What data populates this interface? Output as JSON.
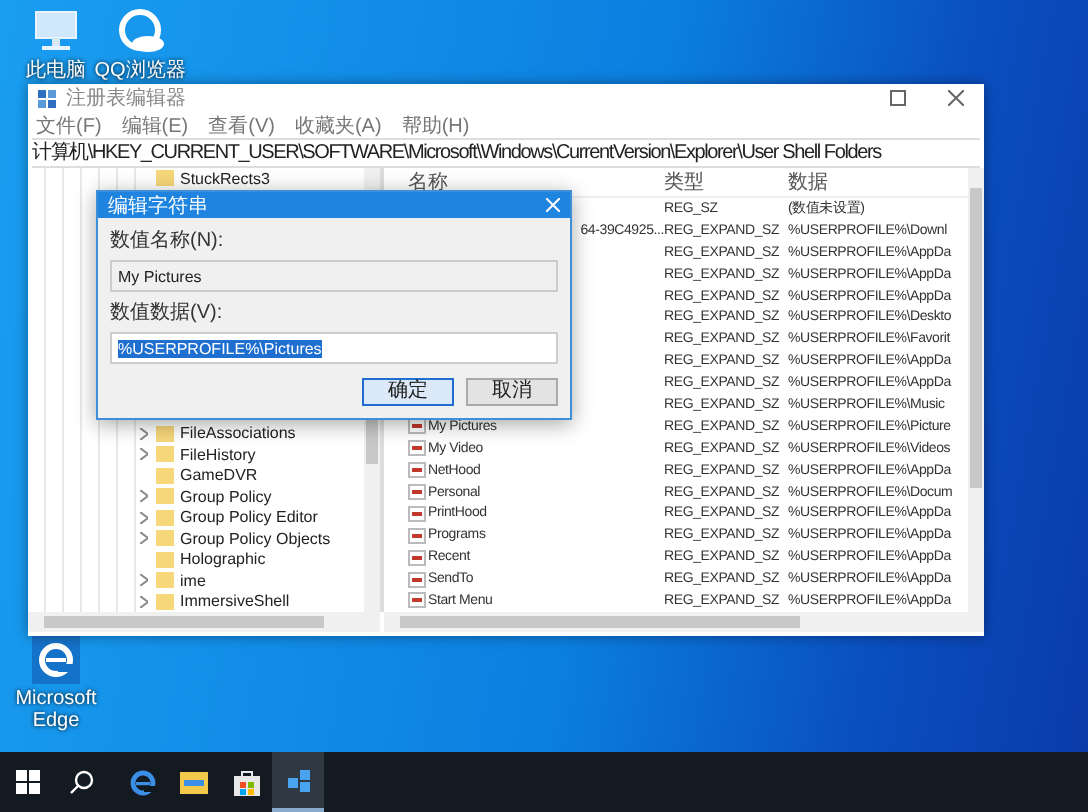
{
  "desktop_icons": [
    {
      "kind": "computer",
      "label": "此电脑"
    },
    {
      "kind": "browser",
      "label": "QQ浏览器"
    },
    {
      "kind": "edge",
      "label": "Microsoft Edge"
    }
  ],
  "window": {
    "title": "注册表编辑器",
    "menu": [
      "文件(F)",
      "编辑(E)",
      "查看(V)",
      "收藏夹(A)",
      "帮助(H)"
    ],
    "address": "计算机\\HKEY_CURRENT_USER\\SOFTWARE\\Microsoft\\Windows\\CurrentVersion\\Explorer\\User Shell Folders"
  },
  "tree": {
    "top_items": [
      {
        "label": "StuckRects3",
        "expandable": false
      }
    ],
    "bottom_items": [
      {
        "label": "FileAssociations",
        "expandable": true
      },
      {
        "label": "FileHistory",
        "expandable": true
      },
      {
        "label": "GameDVR",
        "expandable": false
      },
      {
        "label": "Group Policy",
        "expandable": true
      },
      {
        "label": "Group Policy Editor",
        "expandable": true
      },
      {
        "label": "Group Policy Objects",
        "expandable": true
      },
      {
        "label": "Holographic",
        "expandable": false
      },
      {
        "label": "ime",
        "expandable": true
      },
      {
        "label": "ImmersiveShell",
        "expandable": true
      }
    ]
  },
  "list": {
    "columns": [
      "名称",
      "类型",
      "数据"
    ],
    "rows": [
      {
        "type": "REG_SZ",
        "data": "(数值未设置)"
      },
      {
        "name": "64-39C4925...",
        "name_cut": true,
        "type": "REG_EXPAND_SZ",
        "data": "%USERPROFILE%\\Downl"
      },
      {
        "type": "REG_EXPAND_SZ",
        "data": "%USERPROFILE%\\AppDa"
      },
      {
        "type": "REG_EXPAND_SZ",
        "data": "%USERPROFILE%\\AppDa"
      },
      {
        "type": "REG_EXPAND_SZ",
        "data": "%USERPROFILE%\\AppDa"
      },
      {
        "type": "REG_EXPAND_SZ",
        "data": "%USERPROFILE%\\Deskto"
      },
      {
        "type": "REG_EXPAND_SZ",
        "data": "%USERPROFILE%\\Favorit"
      },
      {
        "type": "REG_EXPAND_SZ",
        "data": "%USERPROFILE%\\AppDa"
      },
      {
        "type": "REG_EXPAND_SZ",
        "data": "%USERPROFILE%\\AppDa"
      },
      {
        "type": "REG_EXPAND_SZ",
        "data": "%USERPROFILE%\\Music"
      },
      {
        "name": "My Pictures",
        "name_cut": false,
        "type": "REG_EXPAND_SZ",
        "data": "%USERPROFILE%\\Picture"
      },
      {
        "name": "My Video",
        "name_cut": false,
        "type": "REG_EXPAND_SZ",
        "data": "%USERPROFILE%\\Videos"
      },
      {
        "name": "NetHood",
        "name_cut": false,
        "type": "REG_EXPAND_SZ",
        "data": "%USERPROFILE%\\AppDa"
      },
      {
        "name": "Personal",
        "name_cut": false,
        "type": "REG_EXPAND_SZ",
        "data": "%USERPROFILE%\\Docum"
      },
      {
        "name": "PrintHood",
        "name_cut": false,
        "type": "REG_EXPAND_SZ",
        "data": "%USERPROFILE%\\AppDa"
      },
      {
        "name": "Programs",
        "name_cut": false,
        "type": "REG_EXPAND_SZ",
        "data": "%USERPROFILE%\\AppDa"
      },
      {
        "name": "Recent",
        "name_cut": false,
        "type": "REG_EXPAND_SZ",
        "data": "%USERPROFILE%\\AppDa"
      },
      {
        "name": "SendTo",
        "name_cut": false,
        "type": "REG_EXPAND_SZ",
        "data": "%USERPROFILE%\\AppDa"
      },
      {
        "name": "Start Menu",
        "name_cut": false,
        "type": "REG_EXPAND_SZ",
        "data": "%USERPROFILE%\\AppDa"
      }
    ]
  },
  "dialog": {
    "title": "编辑字符串",
    "name_label": "数值名称(N):",
    "name_value": "My Pictures",
    "data_label": "数值数据(V):",
    "data_value": "%USERPROFILE%\\Pictures",
    "data_selected": true,
    "buttons": [
      {
        "label": "确定",
        "default": true
      },
      {
        "label": "取消",
        "default": false
      }
    ]
  },
  "taskbar": [
    {
      "kind": "start",
      "active": false
    },
    {
      "kind": "search",
      "active": false
    },
    {
      "kind": "edge",
      "active": false
    },
    {
      "kind": "explorer",
      "active": false
    },
    {
      "kind": "store",
      "active": false
    },
    {
      "kind": "regedit",
      "active": true
    }
  ]
}
